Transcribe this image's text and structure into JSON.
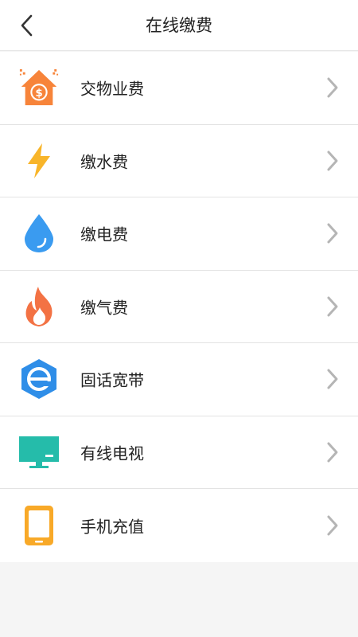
{
  "header": {
    "title": "在线缴费",
    "back_icon": "chevron-left-icon"
  },
  "items": [
    {
      "label": "交物业费",
      "icon": "property-fee-house-icon",
      "color": "#f7843a"
    },
    {
      "label": "缴水费",
      "icon": "lightning-icon",
      "color": "#f8b52a"
    },
    {
      "label": "缴电费",
      "icon": "water-drop-icon",
      "color": "#3a9bf0"
    },
    {
      "label": "缴气费",
      "icon": "flame-icon",
      "color": "#f37244"
    },
    {
      "label": "固话宽带",
      "icon": "broadband-e-icon",
      "color": "#2f8ee8"
    },
    {
      "label": "有线电视",
      "icon": "tv-icon",
      "color": "#25bcaa"
    },
    {
      "label": "手机充值",
      "icon": "mobile-phone-icon",
      "color": "#f8a928"
    }
  ],
  "colors": {
    "background": "#f5f5f5",
    "surface": "#ffffff",
    "divider": "#e3e3e3",
    "chevron": "#b5b5b5"
  }
}
